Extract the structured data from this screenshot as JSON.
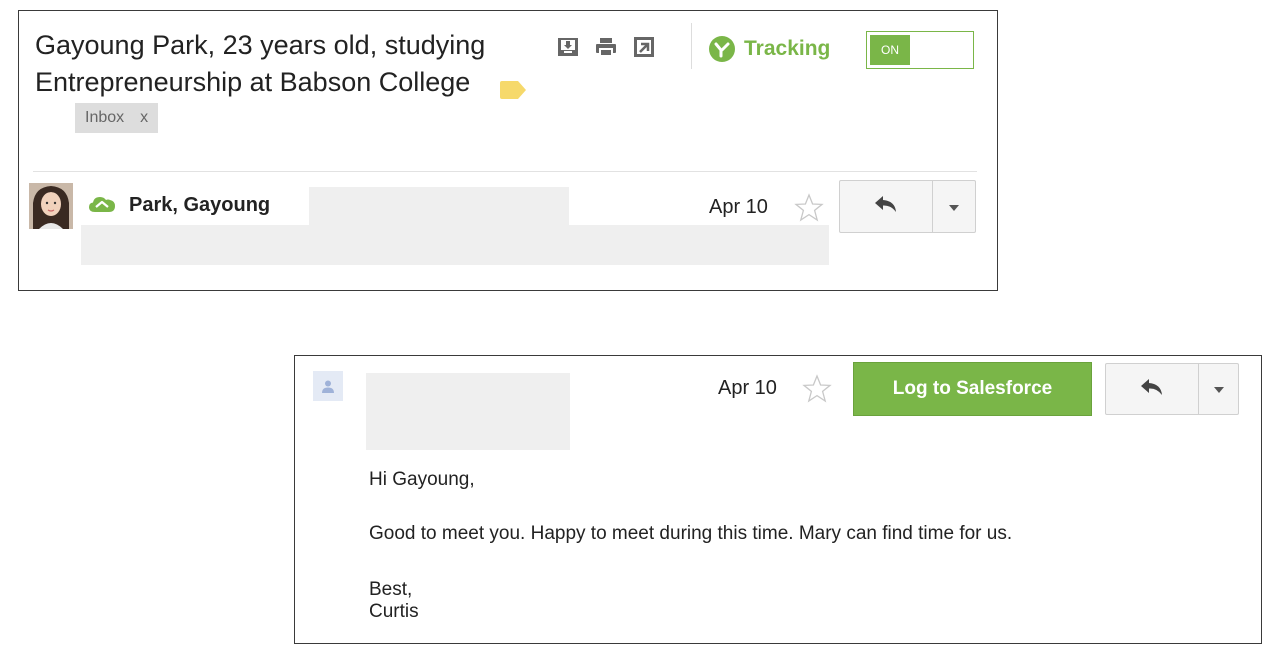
{
  "thread": {
    "subject": "Gayoung Park, 23 years old, studying Entrepreneurship at Babson College",
    "label_chip": {
      "text": "Inbox",
      "remove": "x"
    },
    "label_color": "#f6d96b",
    "toolbar_icons": [
      "download-icon",
      "print-icon",
      "open-new-window-icon"
    ],
    "tracking": {
      "label": "Tracking",
      "toggle_state": "ON",
      "accent": "#7ab648"
    }
  },
  "message1": {
    "sender": "Park, Gayoung",
    "date": "Apr 10",
    "icons": [
      "avatar-photo",
      "salesforce-cloud-icon",
      "star-icon",
      "reply-icon",
      "more-icon"
    ]
  },
  "message2": {
    "date": "Apr 10",
    "log_button": "Log to Salesforce",
    "greeting": "Hi Gayoung,",
    "body": "Good to meet you. Happy to meet during this time. Mary can find time for us.",
    "signoff": "Best,",
    "signature": "Curtis"
  }
}
